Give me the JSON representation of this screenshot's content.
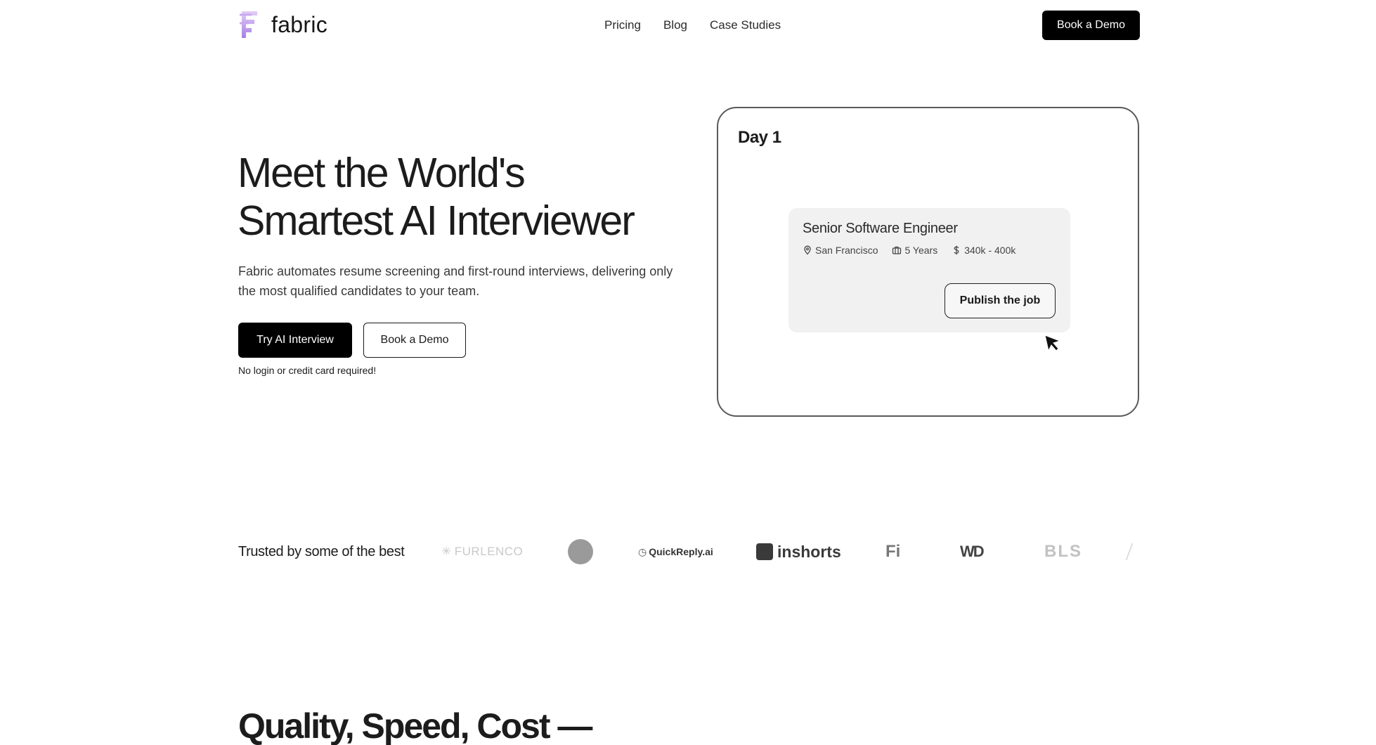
{
  "header": {
    "brand": "fabric",
    "nav": [
      "Pricing",
      "Blog",
      "Case Studies"
    ],
    "cta": "Book a Demo"
  },
  "hero": {
    "title_line1": "Meet the World's",
    "title_line2": "Smartest AI Interviewer",
    "description": "Fabric automates resume screening and first-round interviews, delivering only the most qualified candidates to your team.",
    "primary_button": "Try AI Interview",
    "secondary_button": "Book a Demo",
    "note": "No login or credit card required!"
  },
  "demo": {
    "day": "Day 1",
    "job": {
      "title": "Senior Software Engineer",
      "location": "San Francisco",
      "experience": "5 Years",
      "salary": "340k - 400k",
      "publish_button": "Publish the job"
    }
  },
  "trusted": {
    "label": "Trusted by some of the best",
    "logos": [
      "FURLENCO",
      "QuickReply.ai",
      "inshorts",
      "Fi",
      "WD",
      "BLS"
    ]
  },
  "section": {
    "title": "Quality, Speed, Cost —"
  }
}
